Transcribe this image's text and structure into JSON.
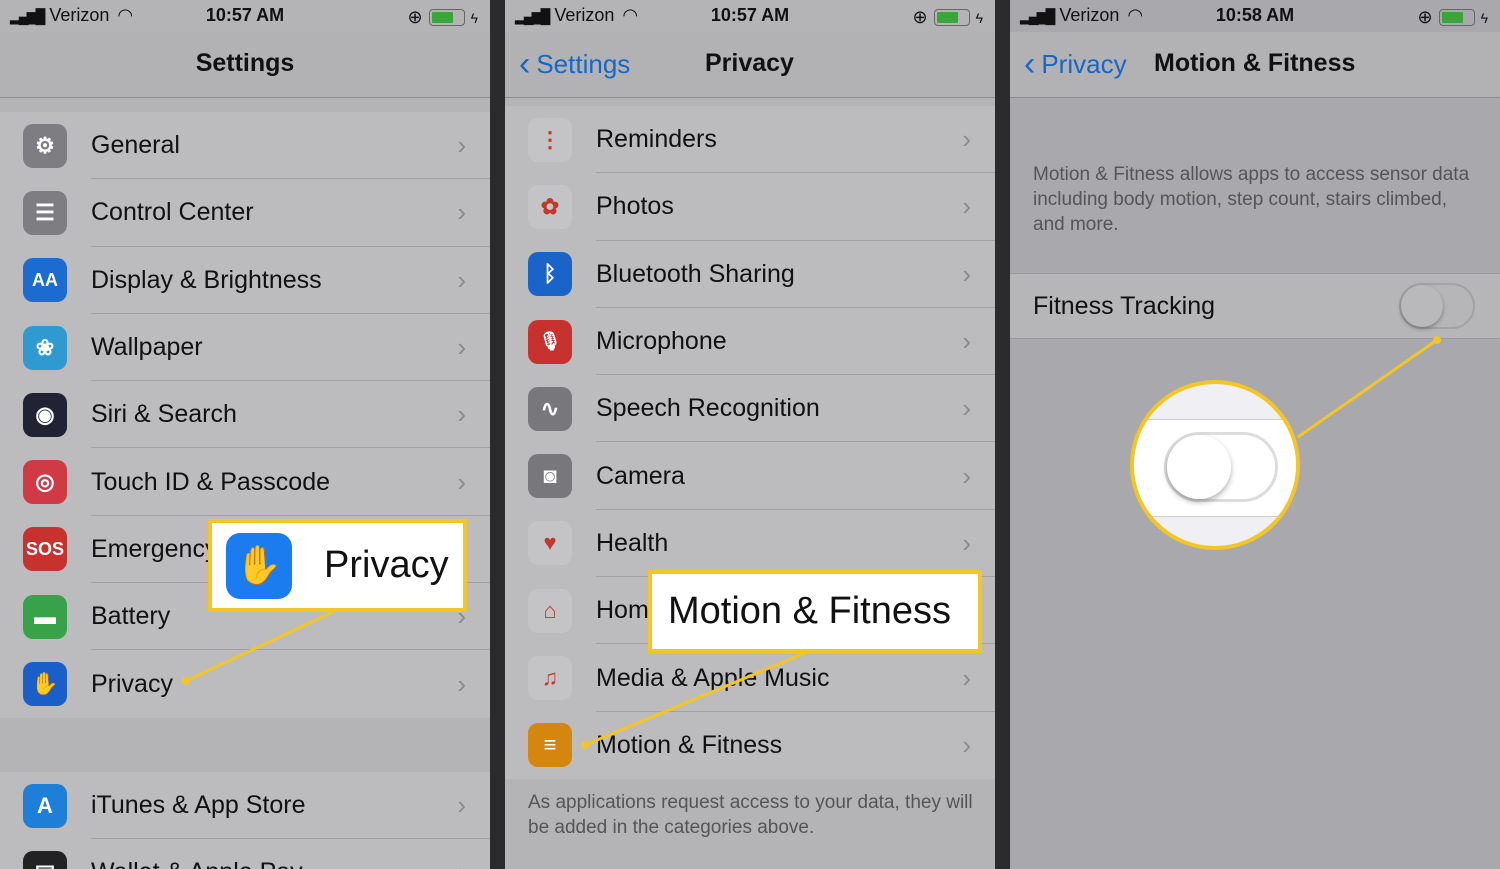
{
  "colors": {
    "accent": "#1667c8",
    "highlight": "#f3c623"
  },
  "screens": [
    {
      "status": {
        "carrier": "Verizon",
        "time": "10:57 AM"
      },
      "title": "Settings",
      "items": [
        {
          "label": "General",
          "icon": "gear-icon",
          "color": "#7d7d82",
          "glyph": "⚙"
        },
        {
          "label": "Control Center",
          "icon": "toggles-icon",
          "color": "#7d7d82",
          "glyph": "☰"
        },
        {
          "label": "Display & Brightness",
          "icon": "text-size-icon",
          "color": "#1c6bd0",
          "glyph": "AA"
        },
        {
          "label": "Wallpaper",
          "icon": "flower-icon",
          "color": "#2e9ad0",
          "glyph": "❀"
        },
        {
          "label": "Siri & Search",
          "icon": "siri-icon",
          "color": "#222235",
          "glyph": "◉"
        },
        {
          "label": "Touch ID & Passcode",
          "icon": "fingerprint-icon",
          "color": "#d03a45",
          "glyph": "◎"
        },
        {
          "label": "Emergency SOS",
          "icon": "sos-icon",
          "color": "#c8322e",
          "glyph": "SOS"
        },
        {
          "label": "Battery",
          "icon": "battery-icon",
          "color": "#37a24a",
          "glyph": "▬"
        },
        {
          "label": "Privacy",
          "icon": "hand-icon",
          "color": "#1a5fc8",
          "glyph": "✋"
        }
      ],
      "items2": [
        {
          "label": "iTunes & App Store",
          "icon": "app-store-icon",
          "color": "#1d7fd8",
          "glyph": "A"
        },
        {
          "label": "Wallet & Apple Pay",
          "icon": "wallet-icon",
          "color": "#222",
          "glyph": "▤"
        }
      ],
      "callout": "Privacy"
    },
    {
      "status": {
        "carrier": "Verizon",
        "time": "10:57 AM"
      },
      "back": "Settings",
      "title": "Privacy",
      "items": [
        {
          "label": "Reminders",
          "icon": "reminders-icon",
          "color": "#c4c4c6",
          "glyph": "⋮"
        },
        {
          "label": "Photos",
          "icon": "photos-icon",
          "color": "#c4c4c6",
          "glyph": "✿"
        },
        {
          "label": "Bluetooth Sharing",
          "icon": "bluetooth-icon",
          "color": "#1a63c9",
          "glyph": "ᛒ"
        },
        {
          "label": "Microphone",
          "icon": "microphone-icon",
          "color": "#c8322e",
          "glyph": "🎙"
        },
        {
          "label": "Speech Recognition",
          "icon": "waveform-icon",
          "color": "#77777c",
          "glyph": "∿"
        },
        {
          "label": "Camera",
          "icon": "camera-icon",
          "color": "#77777c",
          "glyph": "◙"
        },
        {
          "label": "Health",
          "icon": "heart-icon",
          "color": "#c4c4c6",
          "glyph": "♥"
        },
        {
          "label": "HomeKit",
          "icon": "home-icon",
          "color": "#c4c4c6",
          "glyph": "⌂"
        },
        {
          "label": "Media & Apple Music",
          "icon": "music-icon",
          "color": "#c4c4c6",
          "glyph": "♫"
        },
        {
          "label": "Motion & Fitness",
          "icon": "motion-icon",
          "color": "#d5860f",
          "glyph": "≡"
        }
      ],
      "footer": "As applications request access to your data, they will be added in the categories above.",
      "callout": "Motion & Fitness"
    },
    {
      "status": {
        "carrier": "Verizon",
        "time": "10:58 AM"
      },
      "back": "Privacy",
      "title": "Motion & Fitness",
      "description": "Motion & Fitness allows apps to access sensor data including body motion, step count, stairs climbed, and more.",
      "setting": {
        "label": "Fitness Tracking",
        "enabled": false
      }
    }
  ]
}
